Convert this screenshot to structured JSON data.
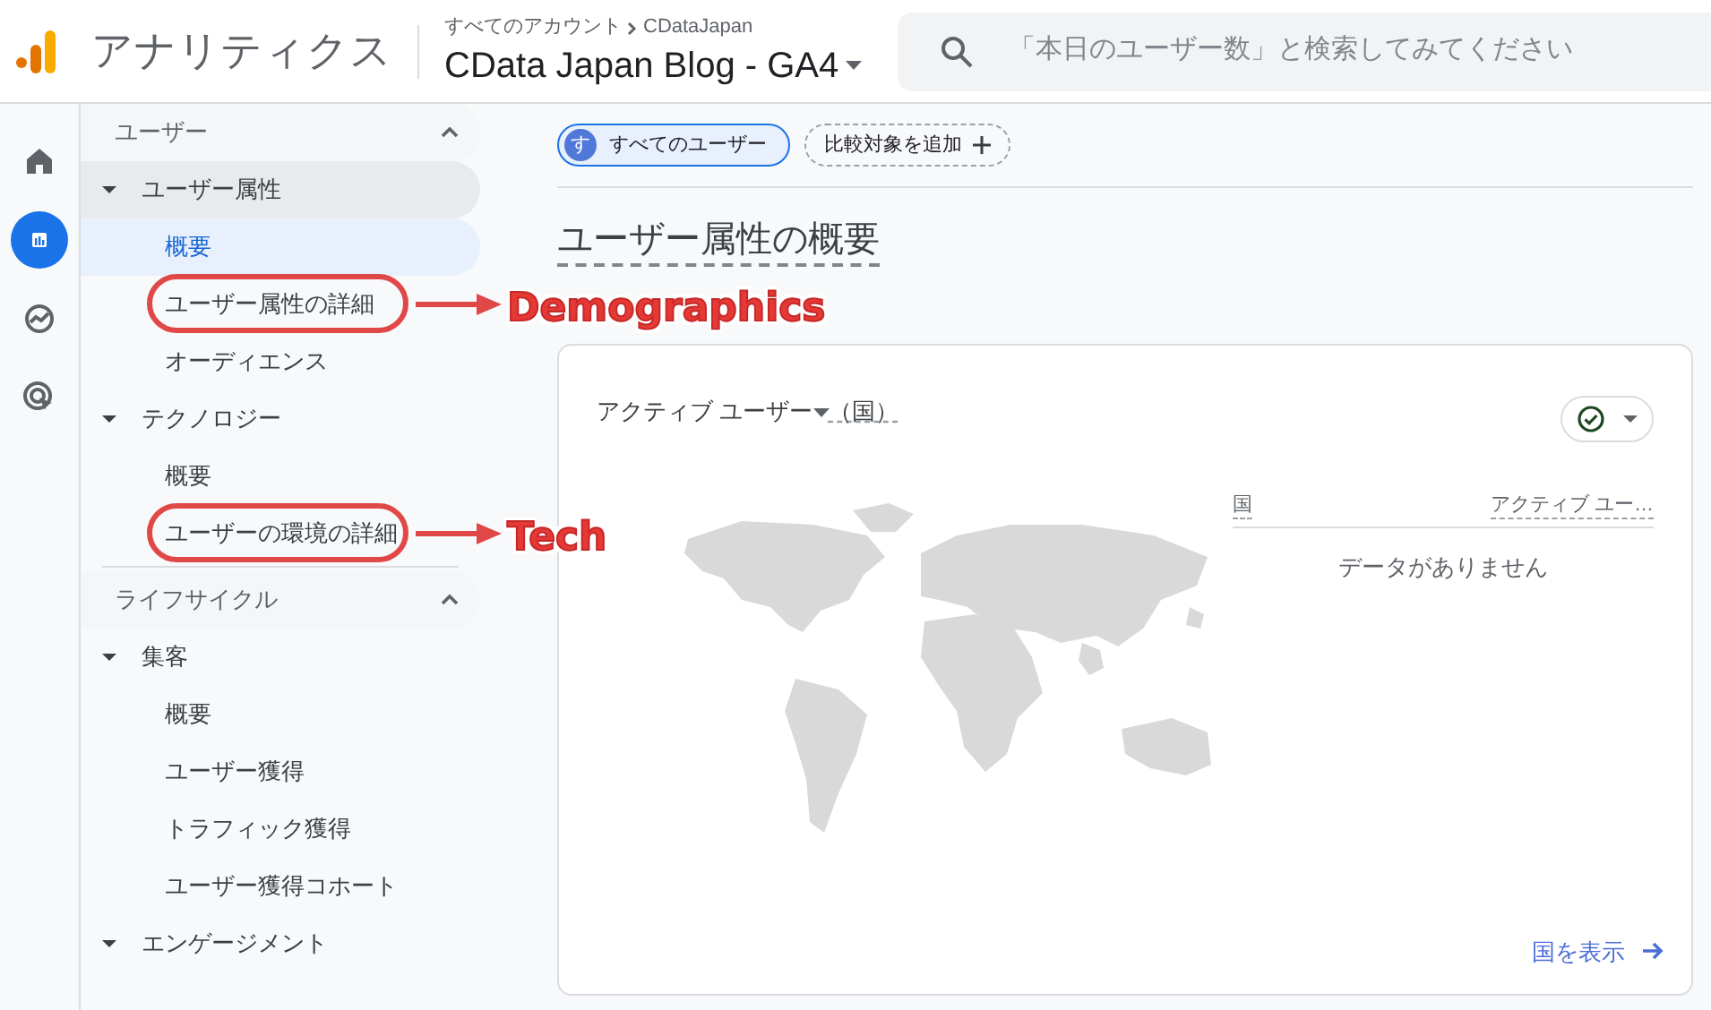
{
  "header": {
    "product": "アナリティクス",
    "breadcrumb": [
      "すべてのアカウント",
      "CDataJapan"
    ],
    "property": "CData Japan Blog - GA4",
    "search": {
      "placeholder": "「本日のユーザー数」と検索してみてください"
    }
  },
  "rail": [
    {
      "kind": "home",
      "selected": false
    },
    {
      "kind": "reports",
      "selected": true
    },
    {
      "kind": "explore",
      "selected": false
    },
    {
      "kind": "advertising",
      "selected": false
    }
  ],
  "nav": [
    {
      "title": "ユーザー",
      "expanded": true,
      "groups": [
        {
          "label": "ユーザー属性",
          "expanded": true,
          "children": [
            {
              "label": "概要",
              "selected": true
            },
            {
              "label": "ユーザー属性の詳細",
              "selected": false,
              "annotation": "Demographics"
            },
            {
              "label": "オーディエンス",
              "selected": false
            }
          ]
        },
        {
          "label": "テクノロジー",
          "expanded": true,
          "children": [
            {
              "label": "概要",
              "selected": false
            },
            {
              "label": "ユーザーの環境の詳細",
              "selected": false,
              "annotation": "Tech"
            }
          ]
        }
      ]
    },
    {
      "title": "ライフサイクル",
      "expanded": true,
      "groups": [
        {
          "label": "集客",
          "expanded": true,
          "children": [
            {
              "label": "概要",
              "selected": false
            },
            {
              "label": "ユーザー獲得",
              "selected": false
            },
            {
              "label": "トラフィック獲得",
              "selected": false
            },
            {
              "label": "ユーザー獲得コホート",
              "selected": false
            }
          ]
        },
        {
          "label": "エンゲージメント",
          "expanded": true
        }
      ]
    }
  ],
  "chips": [
    {
      "kind": "segment",
      "avatar": "す",
      "label": "すべてのユーザー"
    },
    {
      "kind": "add",
      "label": "比較対象を追加"
    }
  ],
  "page_title": "ユーザー属性の概要",
  "card": {
    "metric": "アクティブ ユーザー",
    "dimension": "（国）",
    "table": {
      "columns": [
        "国",
        "アクティブ ユー…"
      ],
      "empty": "データがありません"
    },
    "link": "国を表示"
  }
}
